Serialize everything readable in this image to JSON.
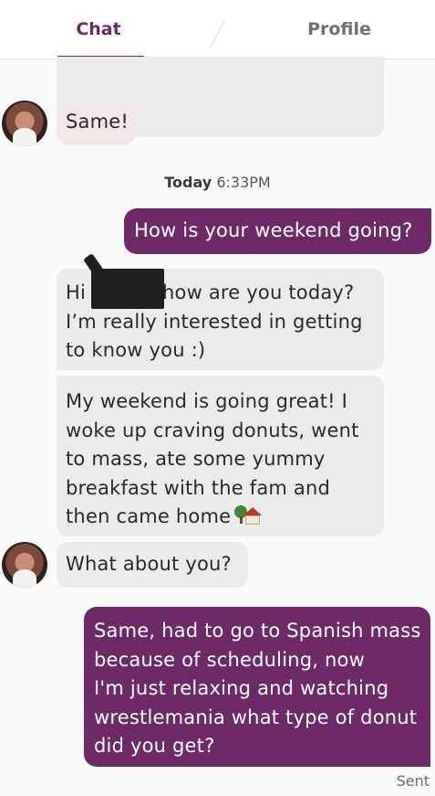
{
  "tabs": {
    "chat": "Chat",
    "profile": "Profile"
  },
  "timestamp": {
    "day": "Today",
    "time": "6:33PM"
  },
  "messages": {
    "same": "Same!",
    "weekend_question": "How is your weekend  going?",
    "greeting_hi": "Hi",
    "greeting_rest": "how are you today?",
    "greeting_line2": "I’m really interested in getting\nto know you :)",
    "weekend_reply": "My weekend is going great! I\nwoke up craving donuts, went\nto mass, ate some yummy\nbreakfast with the fam and\nthen came home",
    "what_about_you": "What about you?",
    "my_reply": "Same, had to go to Spanish mass\nbecause of scheduling, now\nI'm just relaxing and watching\nwrestlemania what type of donut\ndid you get?"
  },
  "status": {
    "sent": "Sent"
  },
  "colors": {
    "accent": "#6d2a67",
    "incoming_bubble": "#ebebec",
    "background": "#fbfafb"
  },
  "icons": {
    "house_with_garden": "house-with-garden-icon"
  }
}
